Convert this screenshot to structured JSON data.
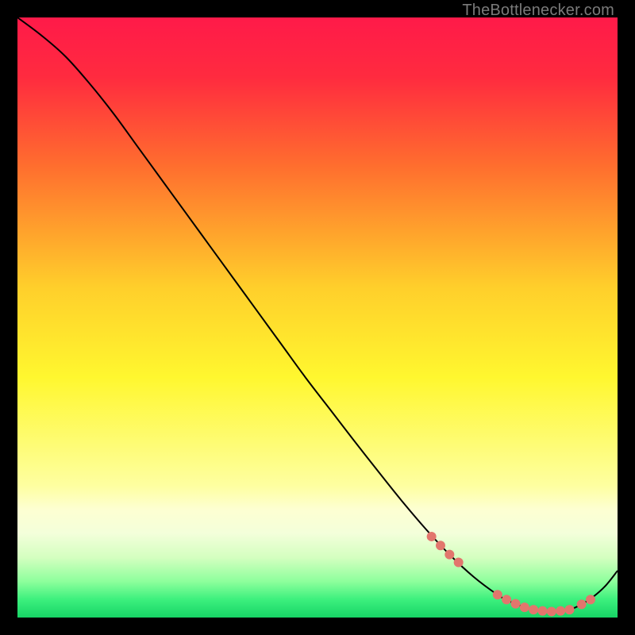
{
  "watermark": "TheBottlenecker.com",
  "chart_data": {
    "type": "line",
    "title": "",
    "xlabel": "",
    "ylabel": "",
    "xlim": [
      0,
      100
    ],
    "ylim": [
      0,
      100
    ],
    "grid": false,
    "legend": false,
    "background_gradient_stops": [
      {
        "offset": 0.0,
        "color": "#ff1a49"
      },
      {
        "offset": 0.1,
        "color": "#ff2b3f"
      },
      {
        "offset": 0.25,
        "color": "#ff6f2e"
      },
      {
        "offset": 0.45,
        "color": "#ffcf2b"
      },
      {
        "offset": 0.6,
        "color": "#fff72f"
      },
      {
        "offset": 0.78,
        "color": "#feffa0"
      },
      {
        "offset": 0.82,
        "color": "#fdffd2"
      },
      {
        "offset": 0.86,
        "color": "#f3ffda"
      },
      {
        "offset": 0.9,
        "color": "#d4ffc0"
      },
      {
        "offset": 0.94,
        "color": "#8dff9c"
      },
      {
        "offset": 0.97,
        "color": "#3cf07d"
      },
      {
        "offset": 1.0,
        "color": "#17d466"
      }
    ],
    "series": [
      {
        "name": "bottleneck-curve",
        "color": "#000000",
        "stroke_width": 2,
        "x": [
          0,
          4,
          8,
          12,
          16,
          20,
          24,
          28,
          32,
          36,
          40,
          44,
          48,
          52,
          56,
          60,
          64,
          68,
          72,
          76,
          80,
          82,
          84,
          86,
          88,
          90,
          92,
          94,
          96,
          98,
          100
        ],
        "y": [
          100,
          97,
          93.5,
          89,
          84,
          78.5,
          73,
          67.5,
          62,
          56.5,
          51,
          45.5,
          40,
          34.8,
          29.6,
          24.5,
          19.5,
          14.8,
          10.5,
          6.8,
          3.8,
          2.7,
          1.9,
          1.3,
          1.0,
          1.0,
          1.3,
          2.2,
          3.5,
          5.3,
          7.8
        ]
      }
    ],
    "markers": {
      "color": "#e2766d",
      "radius": 6,
      "points": [
        {
          "x": 69,
          "y": 13.5
        },
        {
          "x": 70.5,
          "y": 12.0
        },
        {
          "x": 72,
          "y": 10.5
        },
        {
          "x": 73.5,
          "y": 9.2
        },
        {
          "x": 80,
          "y": 3.8
        },
        {
          "x": 81.5,
          "y": 3.0
        },
        {
          "x": 83,
          "y": 2.3
        },
        {
          "x": 84.5,
          "y": 1.7
        },
        {
          "x": 86,
          "y": 1.3
        },
        {
          "x": 87.5,
          "y": 1.1
        },
        {
          "x": 89,
          "y": 1.0
        },
        {
          "x": 90.5,
          "y": 1.1
        },
        {
          "x": 92,
          "y": 1.3
        },
        {
          "x": 94,
          "y": 2.2
        },
        {
          "x": 95.5,
          "y": 3.0
        }
      ]
    }
  }
}
